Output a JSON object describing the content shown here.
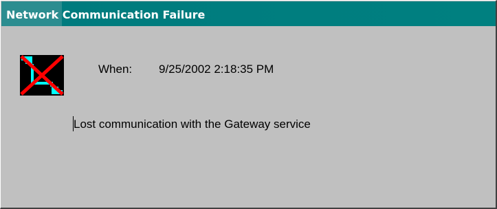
{
  "window": {
    "title": "Network Communication Failure",
    "title_bar_color": "#008080"
  },
  "icon": {
    "name": "network-failure-icon"
  },
  "details": {
    "when_label": "When:",
    "when_value": "9/25/2002 2:18:35 PM"
  },
  "message": {
    "text": "Lost communication with the Gateway service"
  }
}
